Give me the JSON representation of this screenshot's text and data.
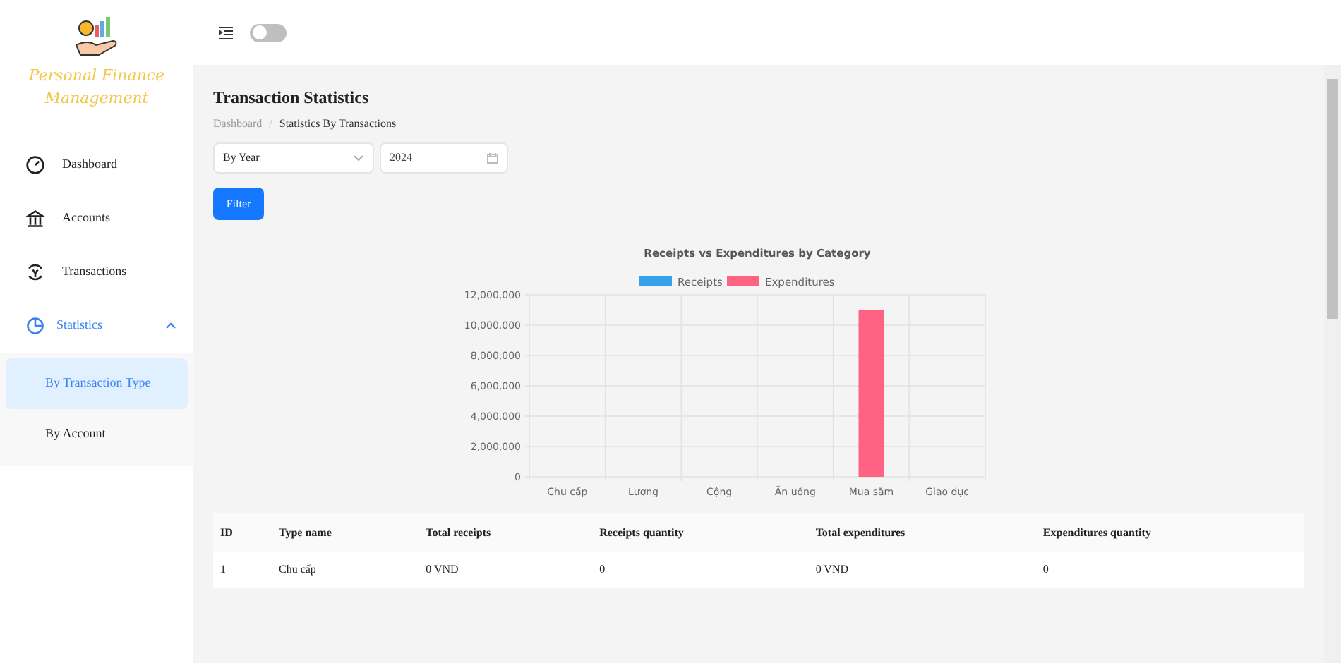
{
  "sidebar": {
    "app_name": "Personal Finance Management",
    "items": [
      {
        "label": "Dashboard",
        "kind": "gauge",
        "selected": false
      },
      {
        "label": "Accounts",
        "kind": "bank",
        "selected": false
      },
      {
        "label": "Transactions",
        "kind": "cycle",
        "selected": false
      },
      {
        "label": "Statistics",
        "kind": "pie",
        "selected": true,
        "expanded": true,
        "children": [
          {
            "label": "By Transaction Type",
            "selected": true
          },
          {
            "label": "By Account",
            "selected": false
          }
        ]
      }
    ]
  },
  "topbar": {
    "theme_toggle_on": false
  },
  "page": {
    "title": "Transaction Statistics",
    "breadcrumb": [
      "Dashboard",
      "Statistics By Transactions"
    ],
    "breadcrumb_separator": "/",
    "period_select": {
      "value": "By Year"
    },
    "year_field": {
      "value": "2024"
    },
    "filter_button": "Filter"
  },
  "chart": {
    "chart_data": {
      "type": "bar",
      "title": "Receipts vs Expenditures by Category",
      "categories": [
        "Chu cấp",
        "Lương",
        "Cộng",
        "Ăn uống",
        "Mua sắm",
        "Giao dục"
      ],
      "series": [
        {
          "name": "Receipts",
          "color": "#36a2eb",
          "values": [
            0,
            0,
            0,
            0,
            0,
            0
          ]
        },
        {
          "name": "Expenditures",
          "color": "#ff6384",
          "values": [
            0,
            0,
            0,
            0,
            11000000,
            0
          ]
        }
      ],
      "ylim": [
        0,
        12000000
      ],
      "grid": true,
      "yticks": [
        {
          "value": 0,
          "label": "0"
        },
        {
          "value": 2000000,
          "label": "2,000,000"
        },
        {
          "value": 4000000,
          "label": "4,000,000"
        },
        {
          "value": 6000000,
          "label": "6,000,000"
        },
        {
          "value": 8000000,
          "label": "8,000,000"
        },
        {
          "value": 10000000,
          "label": "10,000,000"
        },
        {
          "value": 12000000,
          "label": "12,000,000"
        }
      ]
    }
  },
  "table": {
    "columns": [
      "ID",
      "Type name",
      "Total receipts",
      "Receipts quantity",
      "Total expenditures",
      "Expenditures quantity"
    ],
    "rows": [
      [
        "1",
        "Chu cấp",
        "0 VND",
        "0",
        "0 VND",
        "0"
      ]
    ]
  }
}
